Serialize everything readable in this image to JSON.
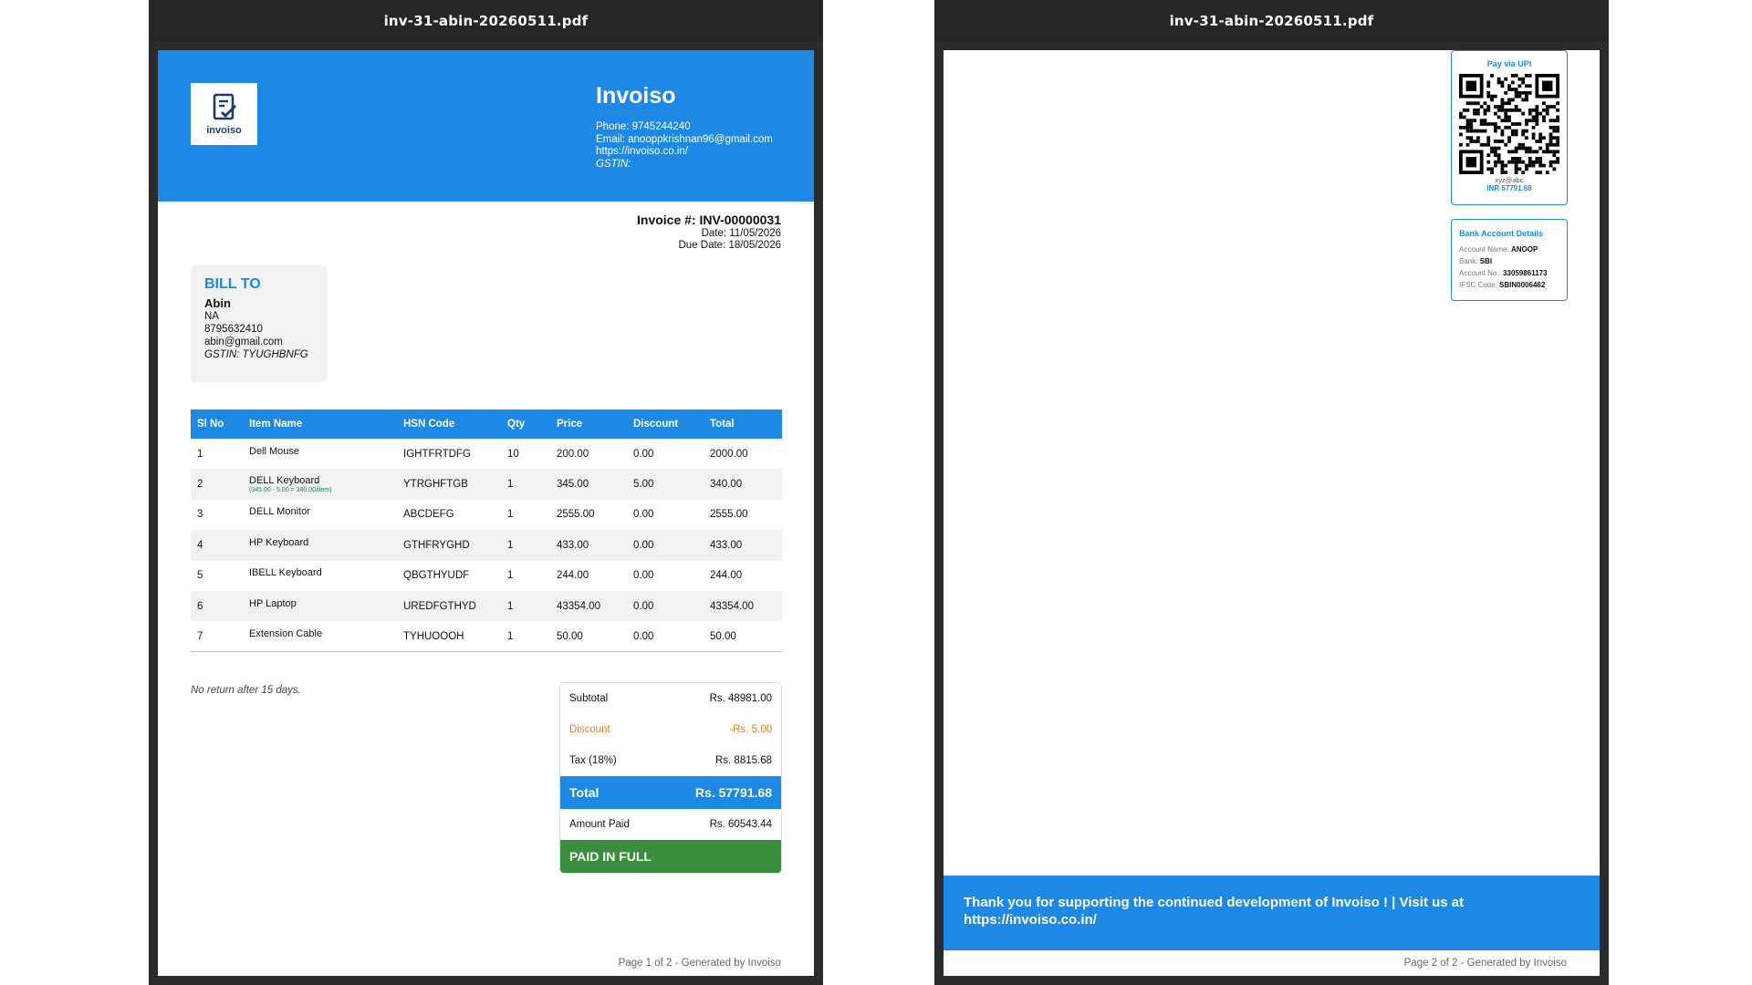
{
  "viewer1": {
    "title": "inv-31-abin-20260511.pdf"
  },
  "viewer2": {
    "title": "inv-31-abin-20260511.pdf"
  },
  "company": {
    "logo_text": "invoiso",
    "name": "Invoiso",
    "phone": "Phone: 9745244240",
    "email": "Email: anooppkrishnan96@gmail.com",
    "website": "https://invoiso.co.in/",
    "gstin": "GSTIN:"
  },
  "invoice": {
    "number": "Invoice #: INV-00000031",
    "date": "Date: 11/05/2026",
    "due_date": "Due Date: 18/05/2026"
  },
  "bill_to": {
    "title": "BILL TO",
    "name": "Abin",
    "address": "NA",
    "phone": "8795632410",
    "email": "abin@gmail.com",
    "gstin": "GSTIN: TYUGHBNFG"
  },
  "table": {
    "headers": [
      "Sl No",
      "Item Name",
      "HSN Code",
      "Qty",
      "Price",
      "Discount",
      "Total"
    ],
    "rows": [
      {
        "sl": "1",
        "name": "Dell Mouse",
        "note": "",
        "hsn": "IGHTFRTDFG",
        "qty": "10",
        "price": "200.00",
        "discount": "0.00",
        "total": "2000.00"
      },
      {
        "sl": "2",
        "name": "DELL Keyboard",
        "note": "(345.00 - 5.00 = 340.00/item)",
        "hsn": "YTRGHFTGB",
        "qty": "1",
        "price": "345.00",
        "discount": "5.00",
        "total": "340.00"
      },
      {
        "sl": "3",
        "name": "DELL Monitor",
        "note": "",
        "hsn": "ABCDEFG",
        "qty": "1",
        "price": "2555.00",
        "discount": "0.00",
        "total": "2555.00"
      },
      {
        "sl": "4",
        "name": "HP Keyboard",
        "note": "",
        "hsn": "GTHFRYGHD",
        "qty": "1",
        "price": "433.00",
        "discount": "0.00",
        "total": "433.00"
      },
      {
        "sl": "5",
        "name": "IBELL Keyboard",
        "note": "",
        "hsn": "QBGTHYUDF",
        "qty": "1",
        "price": "244.00",
        "discount": "0.00",
        "total": "244.00"
      },
      {
        "sl": "6",
        "name": "HP Laptop",
        "note": "",
        "hsn": "UREDFGTHYD",
        "qty": "1",
        "price": "43354.00",
        "discount": "0.00",
        "total": "43354.00"
      },
      {
        "sl": "7",
        "name": "Extension Cable",
        "note": "",
        "hsn": "TYHUOOOH",
        "qty": "1",
        "price": "50.00",
        "discount": "0.00",
        "total": "50.00"
      }
    ]
  },
  "note": "No return after 15 days.",
  "summary": {
    "subtotal_label": "Subtotal",
    "subtotal_value": "Rs. 48981.00",
    "discount_label": "Discount",
    "discount_value": "-Rs. 5.00",
    "tax_label": "Tax (18%)",
    "tax_value": "Rs. 8815.68",
    "total_label": "Total",
    "total_value": "Rs. 57791.68",
    "paid_label": "Amount Paid",
    "paid_value": "Rs. 60543.44",
    "status": "PAID IN FULL"
  },
  "page1_footer": "Page 1 of 2  -  Generated by Invoiso",
  "upi": {
    "title": "Pay via UPI",
    "id": "xyz@abc",
    "amount": "INR 57791.68"
  },
  "bank": {
    "title": "Bank Account Details",
    "name_label": "Account Name:",
    "name_value": "ANOOP",
    "bank_label": "Bank:",
    "bank_value": "SBI",
    "acc_label": "Account No.:",
    "acc_value": "33059861173",
    "ifsc_label": "IFSC Code:",
    "ifsc_value": "SBIN0006462"
  },
  "page2_footer_band": "Thank you for supporting the continued development of Invoiso ! | Visit us at https://invoiso.co.in/",
  "page2_footer": "Page 2 of 2  -  Generated by Invoiso",
  "colors": {
    "accent": "#1e88e5",
    "paid": "#388e3c",
    "discount": "#e67e22"
  },
  "icons": {
    "logo": "invoice-check-icon"
  }
}
